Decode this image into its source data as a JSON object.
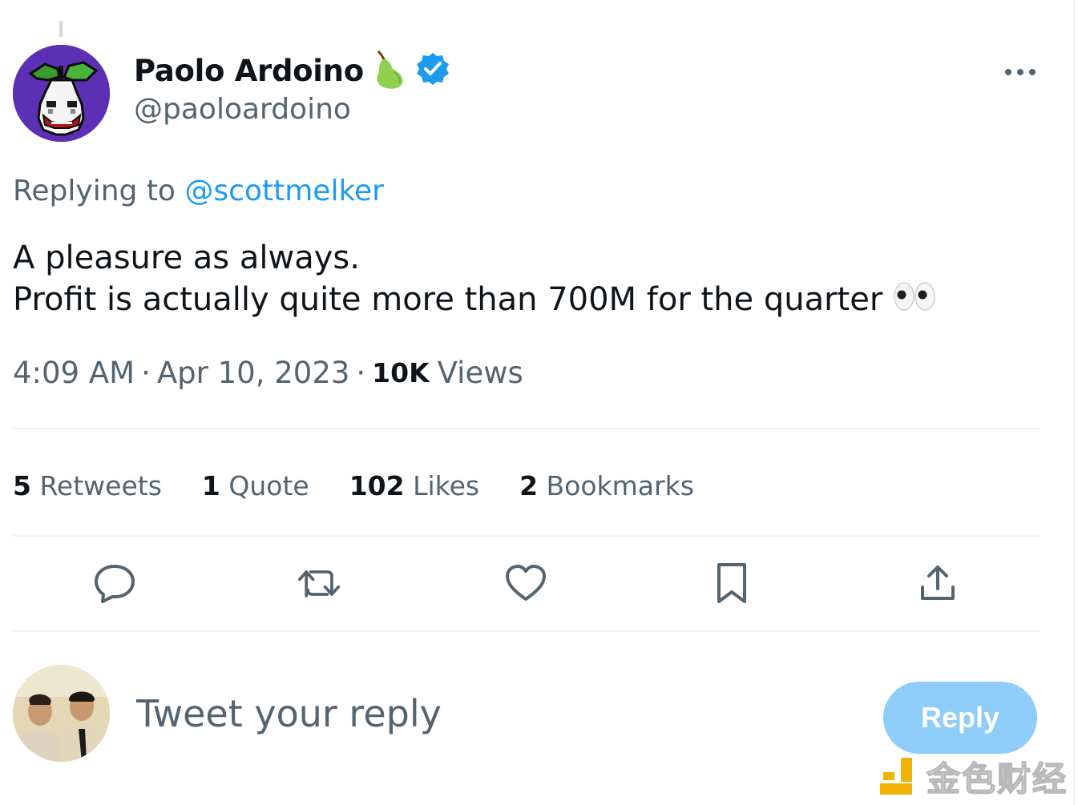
{
  "tweet": {
    "author": {
      "display_name": "Paolo Ardoino",
      "handle": "@paoloardoino",
      "name_emoji": "pear",
      "verified": true
    },
    "replying_to_prefix": "Replying to",
    "replying_to_handle": "@scottmelker",
    "text_line1": "A pleasure as always.",
    "text_line2": "Profit is actually quite more than 700M for the quarter",
    "text_emoji": "👀",
    "time": "4:09 AM",
    "date": "Apr 10, 2023",
    "views_count": "10K",
    "views_label": "Views",
    "separator": "·"
  },
  "stats": {
    "retweets_count": "5",
    "retweets_label": "Retweets",
    "quotes_count": "1",
    "quotes_label": "Quote",
    "likes_count": "102",
    "likes_label": "Likes",
    "bookmarks_count": "2",
    "bookmarks_label": "Bookmarks"
  },
  "actions": [
    "reply-icon",
    "retweet-icon",
    "like-icon",
    "bookmark-icon",
    "share-icon"
  ],
  "composer": {
    "placeholder": "Tweet your reply",
    "button_label": "Reply"
  },
  "watermark": {
    "text": "金色财经"
  },
  "colors": {
    "text_primary": "#0f1419",
    "text_secondary": "#536471",
    "accent": "#1d9bf0",
    "reply_button_disabled": "#8ecdf8",
    "divider": "#eff3f4",
    "avatar_bg": "#5c2fb4",
    "watermark_gold": "#f0b400"
  }
}
